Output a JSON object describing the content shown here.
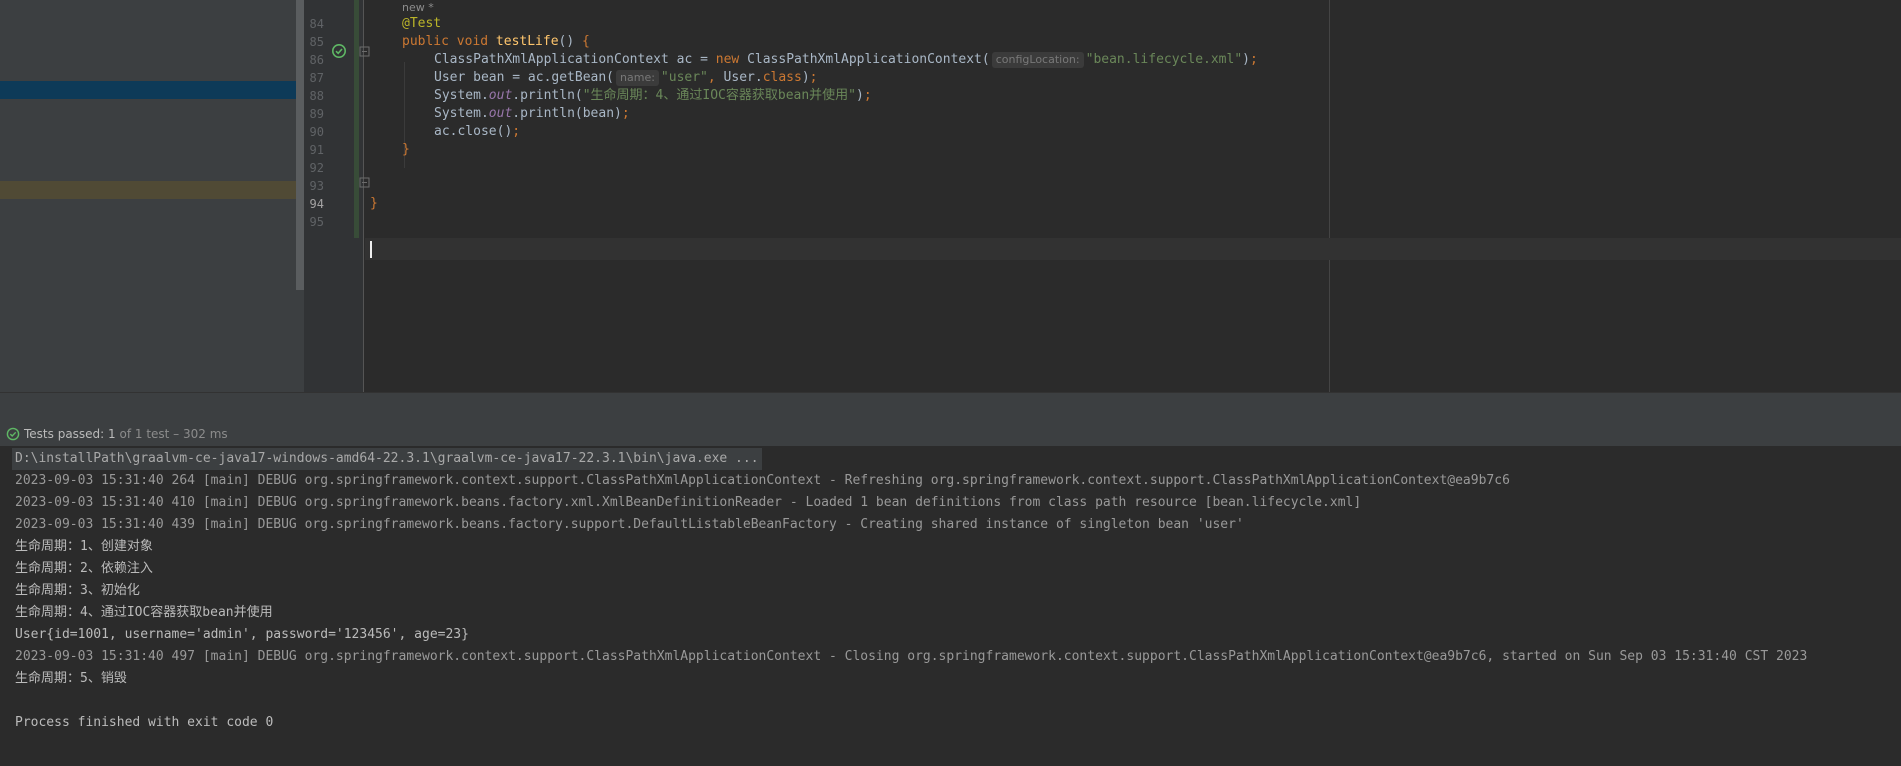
{
  "editor": {
    "usage_hint": "new *",
    "lines": [
      {
        "number": "84",
        "tokens": [
          {
            "cls": "ann",
            "text": "@Test"
          }
        ]
      },
      {
        "number": "85",
        "tokens": [
          {
            "cls": "kw",
            "text": "public void "
          },
          {
            "cls": "fn",
            "text": "testLife"
          },
          {
            "cls": "",
            "text": "() "
          },
          {
            "cls": "kw",
            "text": "{"
          }
        ]
      },
      {
        "number": "86",
        "tokens": [
          {
            "cls": "",
            "text": "ClassPathXmlApplicationContext ac = "
          },
          {
            "cls": "kw",
            "text": "new "
          },
          {
            "cls": "",
            "text": "ClassPathXmlApplicationContext("
          },
          {
            "cls": "hint",
            "text": "configLocation:"
          },
          {
            "cls": "str",
            "text": "\"bean.lifecycle.xml\""
          },
          {
            "cls": "",
            "text": ")"
          },
          {
            "cls": "kw",
            "text": ";"
          }
        ]
      },
      {
        "number": "87",
        "tokens": [
          {
            "cls": "",
            "text": "User bean = ac.getBean("
          },
          {
            "cls": "hint",
            "text": "name:"
          },
          {
            "cls": "str",
            "text": "\"user\""
          },
          {
            "cls": "kw",
            "text": ", "
          },
          {
            "cls": "",
            "text": "User."
          },
          {
            "cls": "kw",
            "text": "class"
          },
          {
            "cls": "",
            "text": ")"
          },
          {
            "cls": "kw",
            "text": ";"
          }
        ]
      },
      {
        "number": "88",
        "tokens": [
          {
            "cls": "",
            "text": "System."
          },
          {
            "cls": "static",
            "text": "out"
          },
          {
            "cls": "",
            "text": ".println("
          },
          {
            "cls": "str",
            "text": "\"生命周期：4、通过IOC容器获取bean并使用\""
          },
          {
            "cls": "",
            "text": ")"
          },
          {
            "cls": "kw",
            "text": ";"
          }
        ]
      },
      {
        "number": "89",
        "tokens": [
          {
            "cls": "",
            "text": "System."
          },
          {
            "cls": "static",
            "text": "out"
          },
          {
            "cls": "",
            "text": ".println(bean)"
          },
          {
            "cls": "kw",
            "text": ";"
          }
        ]
      },
      {
        "number": "90",
        "tokens": [
          {
            "cls": "",
            "text": "ac.close()"
          },
          {
            "cls": "kw",
            "text": ";"
          }
        ]
      },
      {
        "number": "91",
        "tokens": [
          {
            "cls": "kw",
            "text": "}"
          }
        ]
      },
      {
        "number": "92",
        "tokens": []
      },
      {
        "number": "93",
        "tokens": []
      },
      {
        "number": "94",
        "tokens": [
          {
            "cls": "kw",
            "text": "}"
          }
        ]
      },
      {
        "number": "95",
        "tokens": []
      }
    ]
  },
  "run_panel": {
    "status_main": "Tests passed: 1",
    "status_detail": " of 1 test – 302 ms"
  },
  "console": {
    "lines": [
      {
        "type": "cmd",
        "text": "D:\\installPath\\graalvm-ce-java17-windows-amd64-22.3.1\\graalvm-ce-java17-22.3.1\\bin\\java.exe ..."
      },
      {
        "type": "debug",
        "text": "2023-09-03 15:31:40 264 [main] DEBUG org.springframework.context.support.ClassPathXmlApplicationContext - Refreshing org.springframework.context.support.ClassPathXmlApplicationContext@ea9b7c6"
      },
      {
        "type": "debug",
        "text": "2023-09-03 15:31:40 410 [main] DEBUG org.springframework.beans.factory.xml.XmlBeanDefinitionReader - Loaded 1 bean definitions from class path resource [bean.lifecycle.xml]"
      },
      {
        "type": "debug",
        "text": "2023-09-03 15:31:40 439 [main] DEBUG org.springframework.beans.factory.support.DefaultListableBeanFactory - Creating shared instance of singleton bean 'user'"
      },
      {
        "type": "out",
        "text": "生命周期：1、创建对象"
      },
      {
        "type": "out",
        "text": "生命周期：2、依赖注入"
      },
      {
        "type": "out",
        "text": "生命周期：3、初始化"
      },
      {
        "type": "out",
        "text": "生命周期：4、通过IOC容器获取bean并使用"
      },
      {
        "type": "out",
        "text": "User{id=1001, username='admin', password='123456', age=23}"
      },
      {
        "type": "debug",
        "text": "2023-09-03 15:31:40 497 [main] DEBUG org.springframework.context.support.ClassPathXmlApplicationContext - Closing org.springframework.context.support.ClassPathXmlApplicationContext@ea9b7c6, started on Sun Sep 03 15:31:40 CST 2023"
      },
      {
        "type": "out",
        "text": "生命周期：5、销毁"
      },
      {
        "type": "out",
        "text": ""
      },
      {
        "type": "out",
        "text": "Process finished with exit code 0"
      }
    ]
  },
  "icons": {
    "run_gutter": "test-passed-run-icon",
    "status": "check-circle-icon",
    "fold": "fold-marker-icon"
  },
  "colors": {
    "keyword": "#cc7832",
    "annotation": "#bbb529",
    "function": "#ffc66d",
    "string": "#6a8759",
    "success": "#5fb865"
  }
}
